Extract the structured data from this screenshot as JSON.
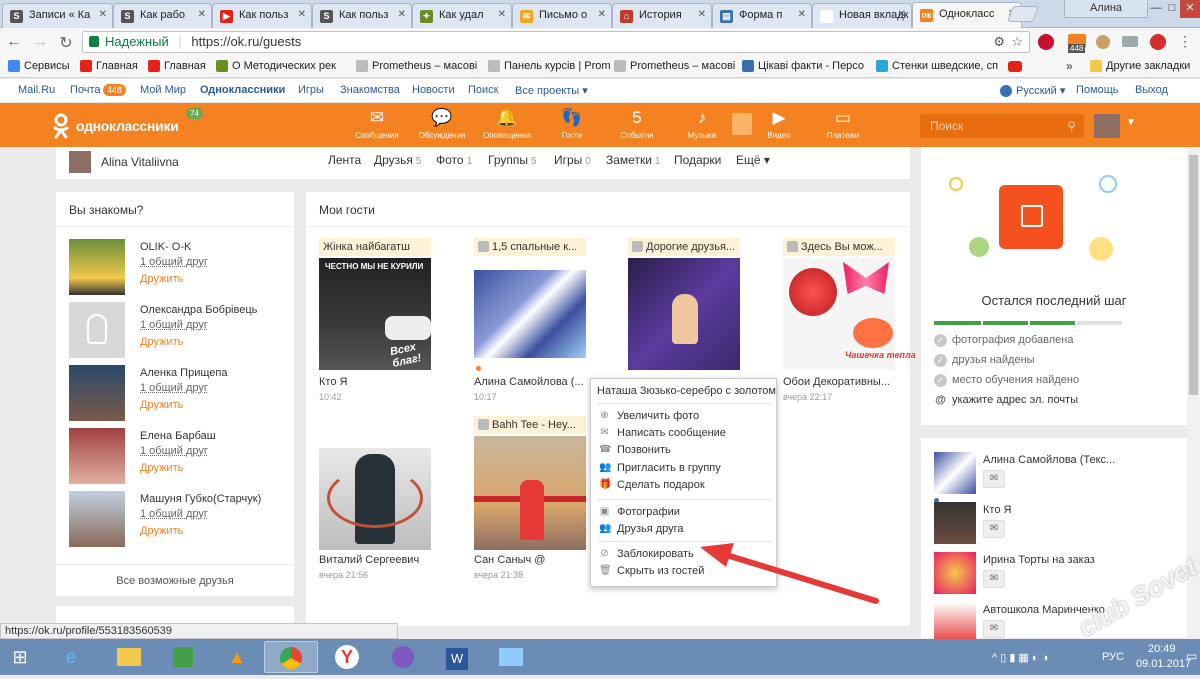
{
  "browser": {
    "tabs": [
      {
        "title": "Записи « Ка",
        "favicon": "S",
        "color": "#555555"
      },
      {
        "title": "Как рабо",
        "favicon": "S",
        "color": "#555555"
      },
      {
        "title": "Как польз",
        "favicon": "▶",
        "color": "#e62117"
      },
      {
        "title": "Как польз",
        "favicon": "S",
        "color": "#555555"
      },
      {
        "title": "Как удал",
        "favicon": "✦",
        "color": "#6b8e23"
      },
      {
        "title": "Письмо о",
        "favicon": "✉",
        "color": "#f5a623"
      },
      {
        "title": "История",
        "favicon": "⌂",
        "color": "#c0392b"
      },
      {
        "title": "Форма п",
        "favicon": "▤",
        "color": "#3a6fb0"
      },
      {
        "title": "Новая вкладк",
        "favicon": "",
        "color": "#ffffff"
      },
      {
        "title": "Однокласс",
        "favicon": "ок",
        "color": "#f58220"
      }
    ],
    "user_label": "Алина",
    "secure_label": "Надежный",
    "url": "https://ok.ru/guests",
    "bookmarks": [
      {
        "label": "Сервисы",
        "color": "#4285f4"
      },
      {
        "label": "Главная",
        "color": "#e62117"
      },
      {
        "label": "Главная",
        "color": "#e62117"
      },
      {
        "label": "О Методических рек",
        "color": "#6b8e23"
      },
      {
        "label": "Prometheus – масові",
        "color": "#bbbbbb"
      },
      {
        "label": "Панель курсів | Prom",
        "color": "#bbbbbb"
      },
      {
        "label": "Prometheus – масові",
        "color": "#bbbbbb"
      },
      {
        "label": "Цікаві факти - Персо",
        "color": "#3a6fb0"
      },
      {
        "label": "Стенки шведские, сп",
        "color": "#2aa6d6"
      }
    ],
    "other_bookmarks": "Другие закладки",
    "status_url": "https://ok.ru/profile/553183560539"
  },
  "mailbar": {
    "links": [
      "Mail.Ru",
      "Почта",
      "Мой Мир",
      "Одноклассники",
      "Игры",
      "Знакомства",
      "Новости",
      "Поиск",
      "Все проекты ▾"
    ],
    "mail_count": "448",
    "lang": "Русский ▾",
    "help": "Помощь",
    "exit": "Выход"
  },
  "header": {
    "logo_text": "одноклассники",
    "logo_badge": "74",
    "nav": [
      {
        "label": "Сообщения",
        "icon": "envelope-icon",
        "glyph": "✉"
      },
      {
        "label": "Обсуждения",
        "icon": "chat-icon",
        "glyph": "💬"
      },
      {
        "label": "Оповещения",
        "icon": "bell-icon",
        "glyph": "🔔"
      },
      {
        "label": "Гости",
        "icon": "footprints-icon",
        "glyph": "👣"
      },
      {
        "label": "События",
        "icon": "events-icon",
        "glyph": "5"
      },
      {
        "label": "Музыка",
        "icon": "music-icon",
        "glyph": "♪"
      },
      {
        "label": "Видео",
        "icon": "video-icon",
        "glyph": "▶"
      },
      {
        "label": "Платежи",
        "icon": "wallet-icon",
        "glyph": "▭"
      }
    ],
    "search_placeholder": "Поиск"
  },
  "profile_bar": {
    "name": "Alina Vitaliivna",
    "tabs": [
      {
        "label": "Лента",
        "count": ""
      },
      {
        "label": "Друзья",
        "count": "5"
      },
      {
        "label": "Фото",
        "count": "1"
      },
      {
        "label": "Группы",
        "count": "5"
      },
      {
        "label": "Игры",
        "count": "0"
      },
      {
        "label": "Заметки",
        "count": "1"
      },
      {
        "label": "Подарки",
        "count": ""
      },
      {
        "label": "Ещё ▾",
        "count": ""
      }
    ]
  },
  "left": {
    "title": "Вы знакомы?",
    "friends": [
      {
        "name": "OLIK- O-K",
        "common": "1 общий друг",
        "add": "Дружить"
      },
      {
        "name": "Олександра Бобрівець",
        "common": "1 общий друг",
        "add": "Дружить"
      },
      {
        "name": "Аленка Прищепа",
        "common": "1 общий друг",
        "add": "Дружить"
      },
      {
        "name": "Елена Барбаш",
        "common": "1 общий друг",
        "add": "Дружить"
      },
      {
        "name": "Машуня Губко(Старчук)",
        "common": "1 общий друг",
        "add": "Дружить"
      }
    ],
    "all_friends": "Все возможные друзья"
  },
  "guests": {
    "title": "Мои гости",
    "cards": [
      {
        "tag": "Жінка найбагатш",
        "name": "Кто Я",
        "time": "10:42",
        "img_text": "ЧЕСТНО МЫ НЕ КУРИЛИ",
        "img_text2": "Всех благ!"
      },
      {
        "tag": "1,5 спальные к...",
        "name": "Алина Самойлова (...",
        "time": "10:17",
        "img_text": "",
        "img_text2": ""
      },
      {
        "tag": "Дорогие друзья...",
        "name": "",
        "time": "",
        "img_text": "",
        "img_text2": ""
      },
      {
        "tag": "Здесь Вы мож...",
        "name": "Обои Декоративны...",
        "time": "вчера 22:17",
        "img_text": "",
        "img_text2": "Чашечка тепла"
      },
      {
        "tag": "",
        "name": "Виталий Сергеевич",
        "time": "вчера 21:56",
        "img_text": "",
        "img_text2": ""
      },
      {
        "tag": "Bahh Tee - Hey...",
        "name": "Сан Саныч @",
        "time": "вчера 21:38",
        "img_text": "",
        "img_text2": ""
      }
    ]
  },
  "context_menu": {
    "header": "Наташа Зюзько-серебро с золотом",
    "items": [
      {
        "label": "Увеличить фото",
        "icon": "zoom-icon",
        "glyph": "⊕"
      },
      {
        "label": "Написать сообщение",
        "icon": "envelope-icon",
        "glyph": "✉"
      },
      {
        "label": "Позвонить",
        "icon": "phone-icon",
        "glyph": "☎"
      },
      {
        "label": "Пригласить в группу",
        "icon": "group-icon",
        "glyph": "👥"
      },
      {
        "label": "Сделать подарок",
        "icon": "gift-icon",
        "glyph": "🎁"
      },
      {
        "label": "Фотографии",
        "icon": "photo-icon",
        "glyph": "▣"
      },
      {
        "label": "Друзья друга",
        "icon": "friends-icon",
        "glyph": "👥"
      },
      {
        "label": "Заблокировать",
        "icon": "block-icon",
        "glyph": "⊘"
      },
      {
        "label": "Скрыть из гостей",
        "icon": "trash-icon",
        "glyph": "🗑"
      }
    ]
  },
  "right": {
    "promo_title": "Остался последний шаг",
    "checklist": [
      {
        "label": "фотография добавлена",
        "done": true
      },
      {
        "label": "друзья найдены",
        "done": true
      },
      {
        "label": "место обучения найдено",
        "done": true
      },
      {
        "label": "укажите адрес эл. почты",
        "done": false
      }
    ],
    "progress": 0.75,
    "guests": [
      {
        "name": "Алина Самойлова (Текс..."
      },
      {
        "name": "Кто Я"
      },
      {
        "name": "Ирина Торты на заказ"
      },
      {
        "name": "Автошкола Маринченко"
      }
    ]
  },
  "watermark": "club Sovet",
  "tray": {
    "lang": "РУС",
    "time": "20:49",
    "date": "09.01.2017"
  },
  "colors": {
    "ok_orange": "#f58220",
    "arrow_red": "#e53935",
    "taskbar": "#6b8cb5"
  }
}
